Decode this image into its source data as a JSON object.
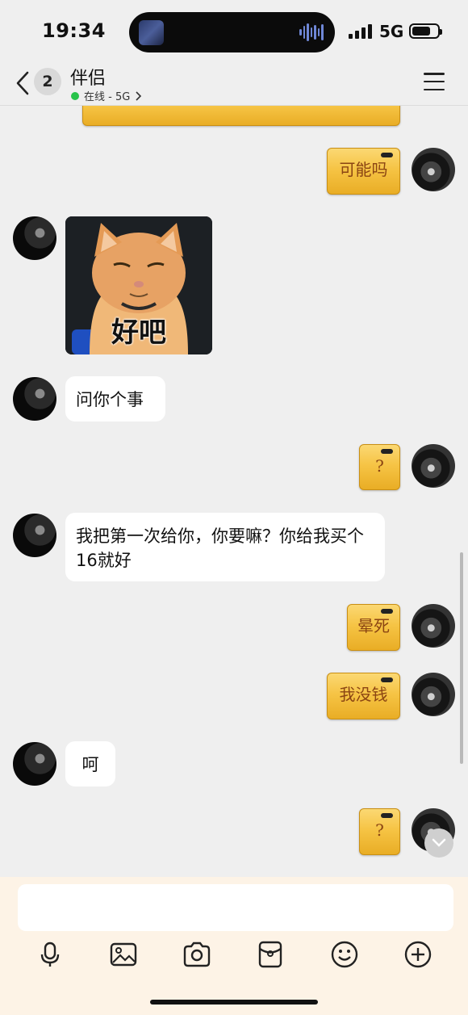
{
  "status_bar": {
    "time": "19:34",
    "network": "5G"
  },
  "header": {
    "unread_count": "2",
    "title": "伴侣",
    "status": "在线 - 5G"
  },
  "messages": [
    {
      "side": "right",
      "type": "gold",
      "text": "可能吗"
    },
    {
      "side": "left",
      "type": "sticker",
      "text": "好吧"
    },
    {
      "side": "left",
      "type": "text",
      "text": "问你个事"
    },
    {
      "side": "right",
      "type": "gold",
      "text": "?"
    },
    {
      "side": "left",
      "type": "text",
      "text": "我把第一次给你，你要嘛？你给我买个16就好"
    },
    {
      "side": "right",
      "type": "gold",
      "text": "晕死"
    },
    {
      "side": "right",
      "type": "gold",
      "text": "我没钱"
    },
    {
      "side": "left",
      "type": "text",
      "text": "呵"
    },
    {
      "side": "right",
      "type": "gold",
      "text": "?"
    }
  ],
  "input": {
    "placeholder": ""
  },
  "toolbar": [
    "microphone-icon",
    "image-icon",
    "camera-icon",
    "red-packet-icon",
    "emoji-icon",
    "plus-icon"
  ],
  "colors": {
    "background": "#efefef",
    "online": "#27c34a",
    "gold": "#f6c445",
    "input_bg": "#fdf3e6"
  }
}
